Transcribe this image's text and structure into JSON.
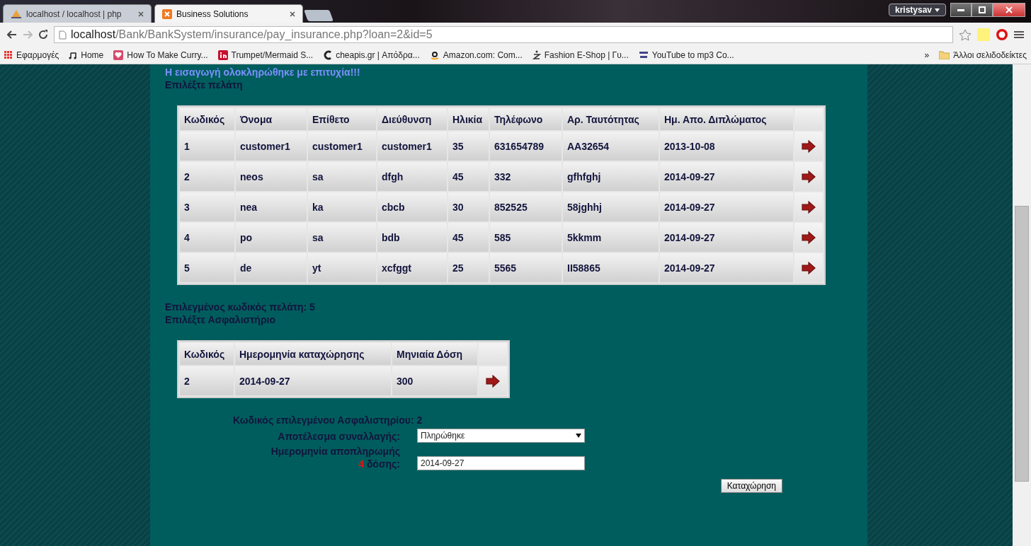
{
  "browser": {
    "tabs": [
      {
        "title": "localhost / localhost | php",
        "selected": false
      },
      {
        "title": "Business Solutions",
        "selected": true
      }
    ],
    "profile": "kristysav",
    "address": {
      "host": "localhost",
      "path": "/Bank/BankSystem/insurance/pay_insurance.php?loan=2&id=5"
    },
    "bookmarks": [
      {
        "kind": "apps",
        "title": "Εφαρμογές"
      },
      {
        "kind": "music",
        "title": "Home"
      },
      {
        "kind": "heart",
        "title": "How To Make Curry..."
      },
      {
        "kind": "in",
        "title": "Trumpet/Mermaid S..."
      },
      {
        "kind": "c",
        "title": "cheapis.gr | Απόδρα..."
      },
      {
        "kind": "amazon",
        "title": "Amazon.com: Com..."
      },
      {
        "kind": "z",
        "title": "Fashion E-Shop | Γυ..."
      },
      {
        "kind": "yt",
        "title": "YouTube to mp3 Co..."
      }
    ],
    "overflow": "»",
    "other_bookmarks": "Άλλοι σελιδοδείκτες"
  },
  "page": {
    "message": "Η εισαγωγή ολοκληρώθηκε με επιτυχία!!!",
    "customers_heading": "Επιλέξτε πελάτη",
    "customers_table": {
      "columns": [
        "Κωδικός",
        "Όνομα",
        "Επίθετο",
        "Διεύθυνση",
        "Ηλικία",
        "Τηλέφωνο",
        "Αρ. Ταυτότητας",
        "Ημ. Απο. Διπλώματος"
      ],
      "rows": [
        [
          "1",
          "customer1",
          "customer1",
          "customer1",
          "35",
          "631654789",
          "AA32654",
          "2013-10-08"
        ],
        [
          "2",
          "neos",
          "sa",
          "dfgh",
          "45",
          "332",
          "gfhfghj",
          "2014-09-27"
        ],
        [
          "3",
          "nea",
          "ka",
          "cbcb",
          "30",
          "852525",
          "58jghhj",
          "2014-09-27"
        ],
        [
          "4",
          "po",
          "sa",
          "bdb",
          "45",
          "585",
          "5kkmm",
          "2014-09-27"
        ],
        [
          "5",
          "de",
          "yt",
          "xcfggt",
          "25",
          "5565",
          "II58865",
          "2014-09-27"
        ]
      ]
    },
    "selected_customer": "Επιλεγμένος κωδικός πελάτη: 5",
    "insurance_heading": "Επιλέξτε Ασφαλιστήριο",
    "insurance_table": {
      "columns": [
        "Κωδικός",
        "Ημερομηνία καταχώρησης",
        "Μηνιαία Δόση"
      ],
      "rows": [
        [
          "2",
          "2014-09-27",
          "300"
        ]
      ]
    },
    "selected_insurance": "Κωδικός επιλεγμένου Ασφαλιστηρίου: 2",
    "fields": [
      {
        "kind": "select",
        "label": "Αποτέλεσμα συναλλαγής:",
        "value": "Πληρώθηκε"
      },
      {
        "kind": "input",
        "label": "Ημερομηνία αποπληρωμής",
        "number": "4",
        "label_end": "δόσης:",
        "value": "2014-09-27"
      }
    ],
    "submit": "Καταχώρηση"
  }
}
